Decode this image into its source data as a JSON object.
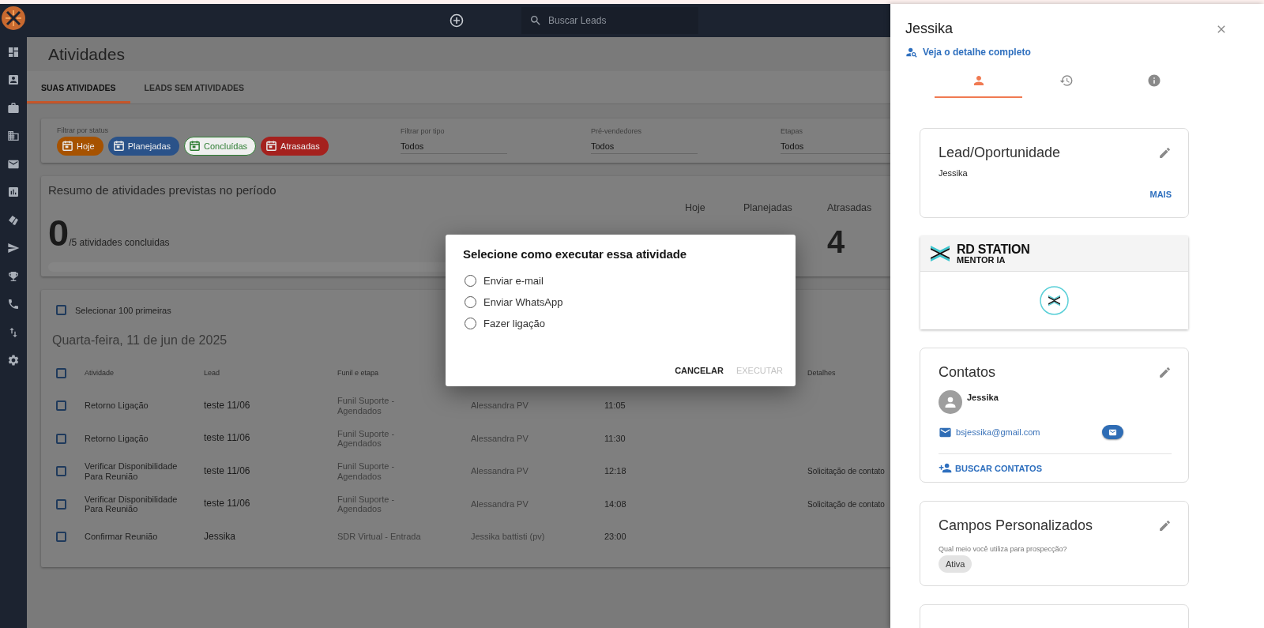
{
  "topbar": {
    "search": {
      "placeholder": "Buscar Leads"
    }
  },
  "page": {
    "title": "Atividades"
  },
  "tabs": [
    {
      "label": "SUAS ATIVIDADES",
      "selected": true
    },
    {
      "label": "LEADS SEM ATIVIDADES",
      "selected": false
    }
  ],
  "filters": {
    "status_label": "Filtrar por status",
    "status_chips": [
      {
        "label": "Hoje",
        "color": "#a65200",
        "selected": true
      },
      {
        "label": "Planejadas",
        "color": "#2a5289",
        "selected": true
      },
      {
        "label": "Concluídas",
        "color": "#2e7d32",
        "selected": false
      },
      {
        "label": "Atrasadas",
        "color": "#a5211e",
        "selected": true
      }
    ],
    "selects": [
      {
        "label": "Filtrar por tipo",
        "value": "Todos"
      },
      {
        "label": "Pré-vendedores",
        "value": "Todos"
      },
      {
        "label": "Etapas",
        "value": "Todos"
      }
    ]
  },
  "summary": {
    "title": "Resumo de atividades previstas no período",
    "done": "0",
    "total_text": "/5 atividades concluidas",
    "level": 0,
    "stats": [
      {
        "label": "Hoje"
      },
      {
        "label": "Planejadas"
      },
      {
        "label": "Atrasadas",
        "value": "4"
      }
    ]
  },
  "activities": {
    "select_all": {
      "label": "Selecionar 100 primeiras",
      "checked": false
    },
    "date": "Quarta-feira, 11 de jun de 2025",
    "header_checked": false,
    "columns": {
      "activity": "Atividade",
      "lead": "Lead",
      "funnel": "Funil e etapa",
      "details": "Detalhes"
    },
    "rows": [
      {
        "checked": false,
        "activity": "Retorno Ligação",
        "lead": "teste 11/06",
        "funnel": "Funil Suporte - Agendados",
        "column_4": "Alessandra PV",
        "column_5": "11:05"
      },
      {
        "checked": false,
        "activity": "Retorno Ligação",
        "lead": "teste 11/06",
        "funnel": "Funil Suporte - Agendados",
        "column_4": "Alessandra PV",
        "column_5": "11:30"
      },
      {
        "checked": false,
        "activity": "Verificar Disponibilidade Para Reunião",
        "lead": "teste 11/06",
        "funnel": "Funil Suporte - Agendados",
        "column_4": "Alessandra PV",
        "column_5": "12:18",
        "details": "Solicitação de contato"
      },
      {
        "checked": false,
        "activity": "Verificar Disponibilidade Para Reunião",
        "lead": "teste 11/06",
        "funnel": "Funil Suporte - Agendados",
        "column_4": "Alessandra PV",
        "column_5": "14:08",
        "details": "Solicitação de contato"
      },
      {
        "checked": false,
        "activity": "Confirmar Reunião",
        "lead": "Jessika",
        "funnel": "SDR Virtual - Entrada",
        "column_4": "Jessika battisti (pv)",
        "column_5": "23:00"
      }
    ]
  },
  "dialog": {
    "title": "Selecione como executar essa atividade",
    "options": [
      {
        "label": "Enviar e-mail",
        "selected": false
      },
      {
        "label": "Enviar WhatsApp",
        "selected": false
      },
      {
        "label": "Fazer ligação",
        "selected": false
      }
    ],
    "buttons": [
      {
        "label": "CANCELAR",
        "disabled": false
      },
      {
        "label": "EXECUTAR",
        "disabled": true
      }
    ]
  },
  "drawer": {
    "title": "Jessika",
    "detail_link": "Veja o detalhe completo",
    "tabs": [
      {
        "kind": "person",
        "selected": true
      },
      {
        "kind": "history",
        "selected": false
      },
      {
        "kind": "info",
        "selected": false
      }
    ],
    "lead_card": {
      "title": "Lead/Oportunidade",
      "value": "Jessika",
      "more": "MAIS"
    },
    "mentor_card": {
      "brand": "RD STATION",
      "subtitle": "MENTOR IA"
    },
    "contacts_card": {
      "title": "Contatos",
      "contacts": [
        {
          "name": "Jessika",
          "email": "bsjessika@gmail.com"
        }
      ],
      "action": "BUSCAR CONTATOS"
    },
    "custom_fields_card": {
      "title": "Campos Personalizados",
      "fields": [
        {
          "question": "Qual meio você utiliza para prospecção?",
          "value": "Ativa"
        }
      ]
    }
  }
}
